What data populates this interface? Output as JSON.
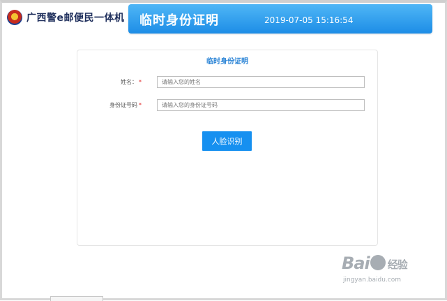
{
  "brand": {
    "name": "广西警e邮便民一体机"
  },
  "header": {
    "title": "临时身份证明",
    "datetime": "2019-07-05 15:16:54"
  },
  "form": {
    "title": "临时身份证明",
    "name_field": {
      "label": "姓名：",
      "required_mark": "*",
      "placeholder": "请输入您的姓名",
      "value": ""
    },
    "id_field": {
      "label": "身份证号码",
      "required_mark": "*",
      "placeholder": "请输入您的身份证号码",
      "value": ""
    },
    "submit_label": "人脸识别"
  },
  "watermark": {
    "main_left": "Bai",
    "main_right": "经验",
    "sub": "jingyan.baidu.com"
  },
  "colors": {
    "accent": "#1690f0",
    "header_gradient_top": "#4fb6f6",
    "header_gradient_bottom": "#1d8de6",
    "required": "#e02020"
  },
  "icons": {
    "emblem": "police-emblem-icon",
    "watermark_paw": "baidu-paw-icon"
  }
}
